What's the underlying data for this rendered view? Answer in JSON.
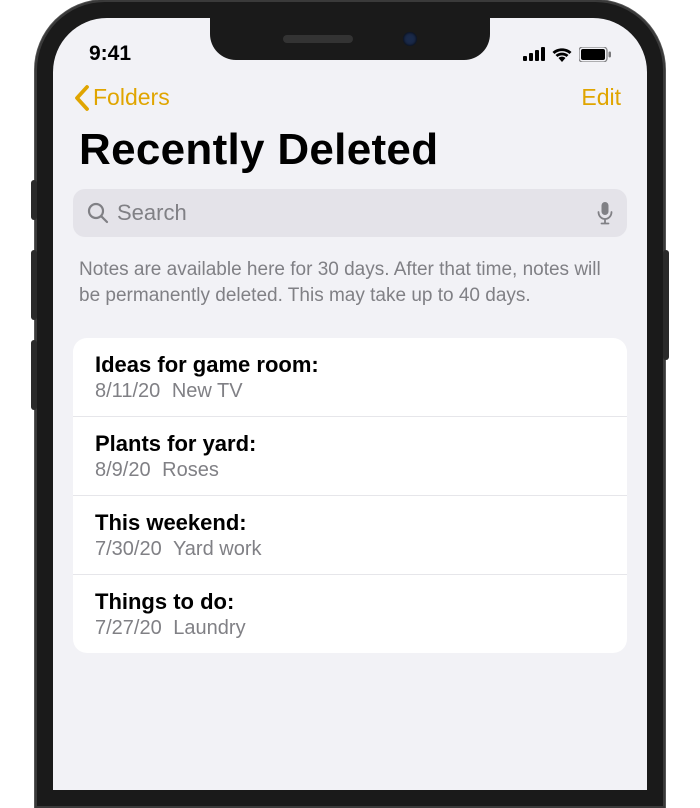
{
  "status": {
    "time": "9:41"
  },
  "nav": {
    "back_label": "Folders",
    "edit_label": "Edit"
  },
  "page": {
    "title": "Recently Deleted"
  },
  "search": {
    "placeholder": "Search"
  },
  "info": {
    "text": "Notes are available here for 30 days. After that time, notes will be permanently deleted. This may take up to 40 days."
  },
  "notes": [
    {
      "title": "Ideas for game room:",
      "date": "8/11/20",
      "preview": "New TV"
    },
    {
      "title": "Plants for yard:",
      "date": "8/9/20",
      "preview": "Roses"
    },
    {
      "title": "This weekend:",
      "date": "7/30/20",
      "preview": "Yard work"
    },
    {
      "title": "Things to do:",
      "date": "7/27/20",
      "preview": "Laundry"
    }
  ]
}
